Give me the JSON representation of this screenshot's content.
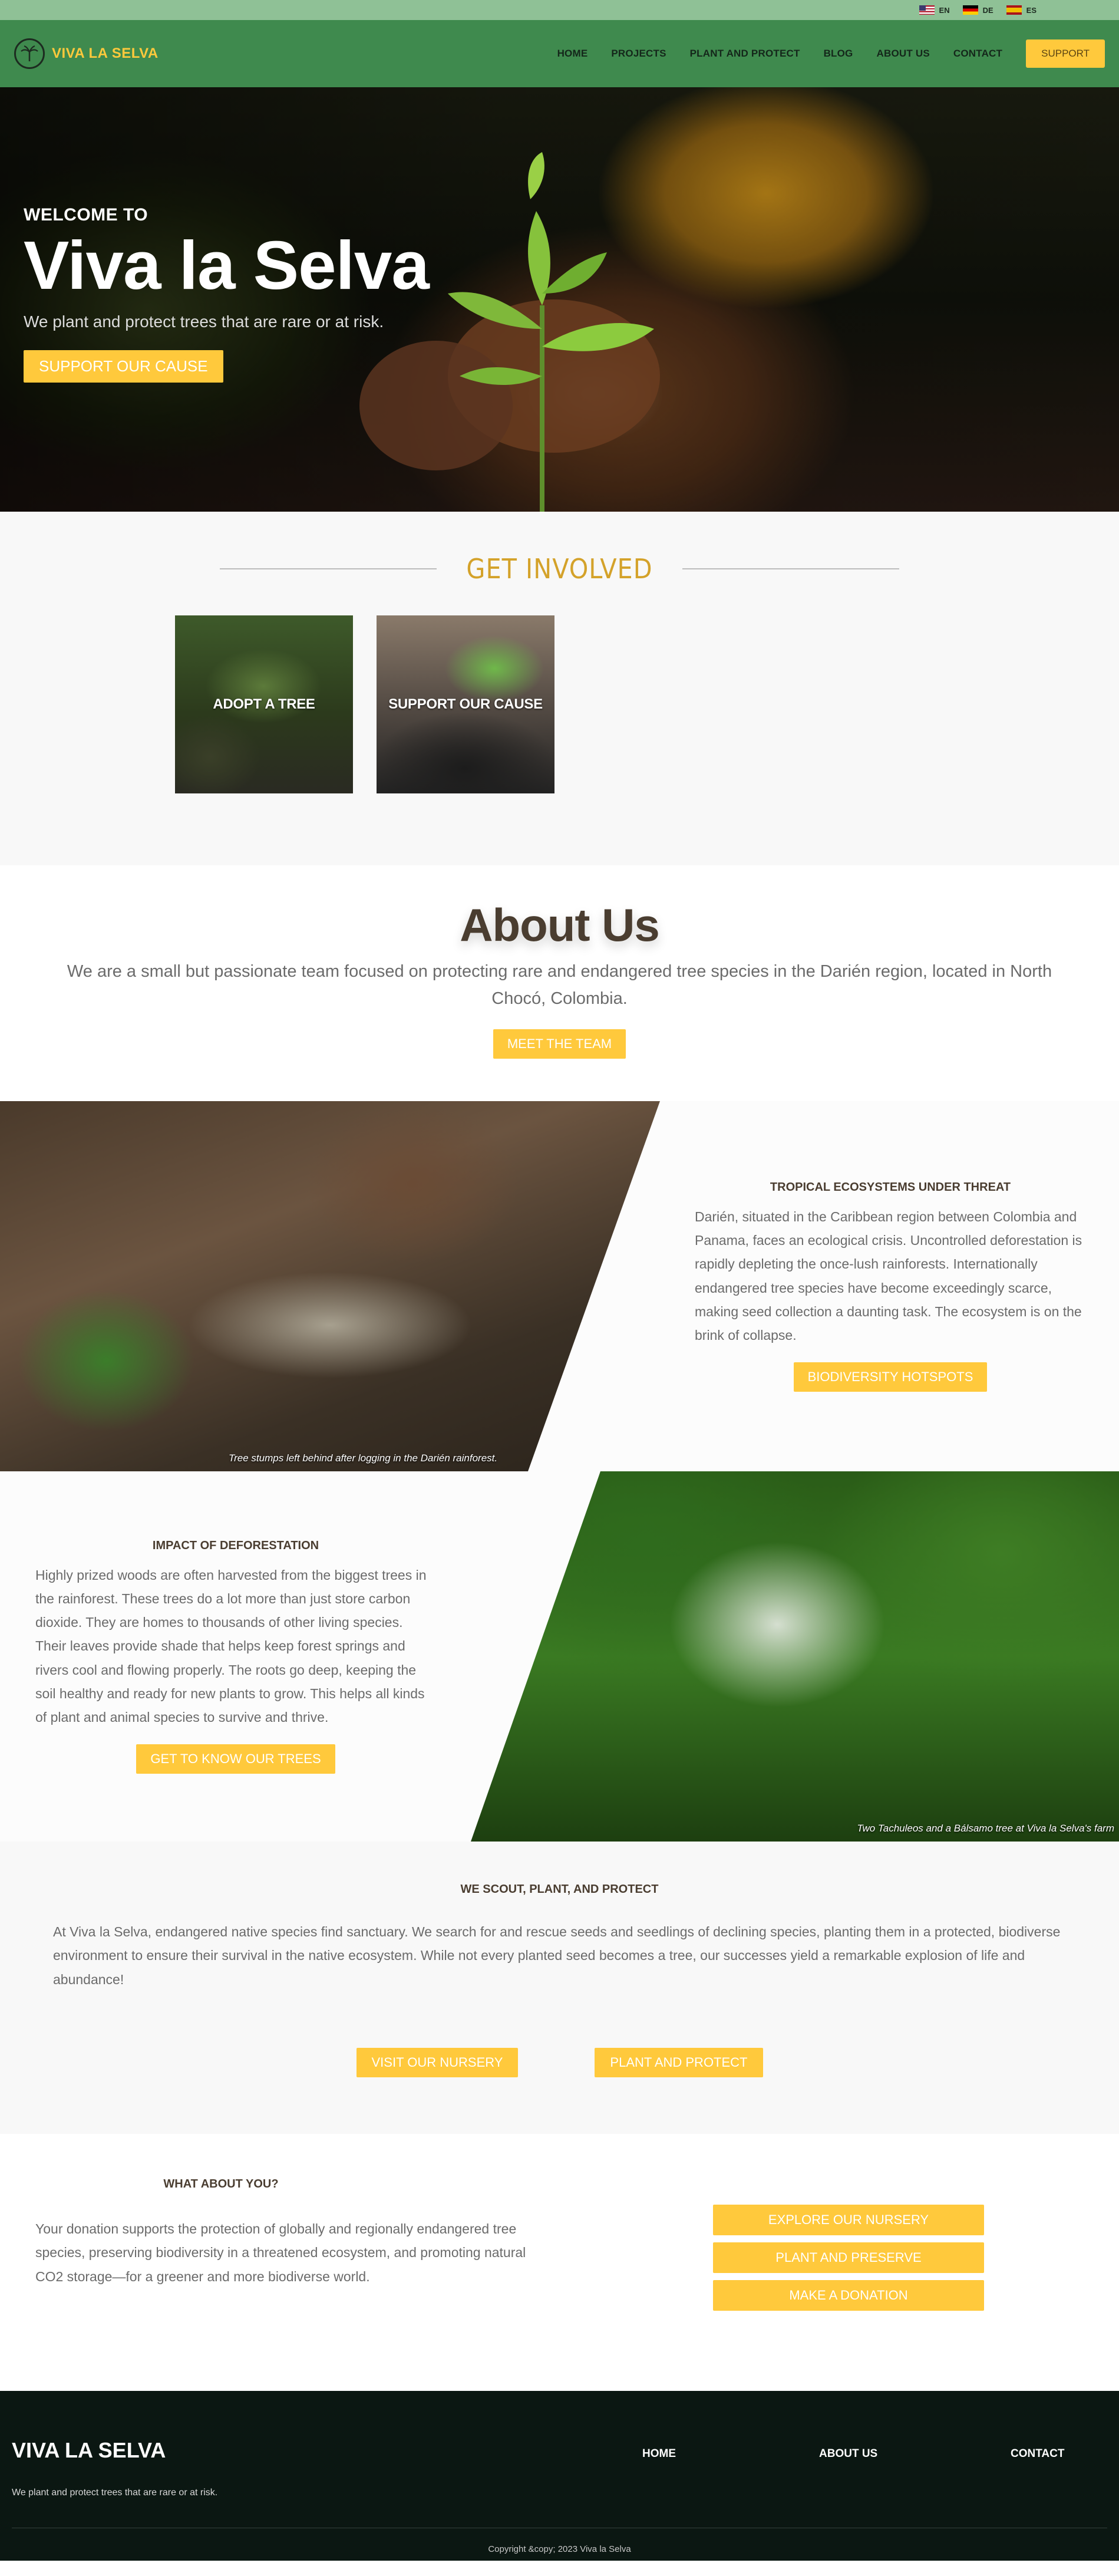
{
  "languages": [
    {
      "code": "EN"
    },
    {
      "code": "DE"
    },
    {
      "code": "ES"
    }
  ],
  "header": {
    "brand": "VIVA LA SELVA",
    "nav": [
      "HOME",
      "PROJECTS",
      "PLANT AND PROTECT",
      "BLOG",
      "ABOUT US",
      "CONTACT"
    ],
    "support_button": "SUPPORT"
  },
  "hero": {
    "welcome": "WELCOME TO",
    "title": "Viva la Selva",
    "subtitle": "We plant and protect trees that are rare or at risk.",
    "cta": "SUPPORT OUR CAUSE"
  },
  "involved": {
    "title": "GET INVOLVED",
    "cards": [
      "ADOPT A TREE",
      "SUPPORT OUR CAUSE"
    ]
  },
  "about": {
    "title": "About Us",
    "text": "We are a small but passionate team focused on protecting rare and endangered tree species in the Darién region, located in North Chocó, Colombia.",
    "button": "MEET THE TEAM"
  },
  "threat": {
    "heading": "TROPICAL ECOSYSTEMS UNDER THREAT",
    "body": "Darién, situated in the Caribbean region between Colombia and Panama, faces an ecological crisis. Uncontrolled deforestation is rapidly depleting the once-lush rainforests. Internationally endangered tree species have become exceedingly scarce, making seed collection a daunting task. The ecosystem is on the brink of collapse.",
    "button": "BIODIVERSITY HOTSPOTS",
    "caption": "Tree stumps left behind after logging in the Darién rainforest."
  },
  "impact": {
    "heading": "IMPACT OF DEFORESTATION",
    "body": "Highly prized woods are often harvested from the biggest trees in the rainforest. These trees do a lot more than just store carbon dioxide. They are homes to thousands of other living species. Their leaves provide shade that helps keep forest springs and rivers cool and flowing properly. The roots go deep, keeping the soil healthy and ready for new plants to grow. This helps all kinds of plant and animal species to survive and thrive.",
    "button": "GET TO KNOW OUR TREES",
    "caption": "Two Tachuleos and a Bálsamo tree at Viva la Selva's farm"
  },
  "scout": {
    "heading": "WE SCOUT, PLANT, AND PROTECT",
    "body": "At Viva la Selva, endangered native species find sanctuary. We search for and rescue seeds and seedlings of declining species, planting them in a protected, biodiverse environment to ensure their survival in the native ecosystem. While not every planted seed becomes a tree, our successes yield a remarkable explosion of life and abundance!",
    "buttons": [
      "VISIT OUR NURSERY",
      "PLANT AND PROTECT"
    ]
  },
  "you": {
    "heading": "WHAT ABOUT YOU?",
    "body": "Your donation supports the protection of globally and regionally endangered tree species, preserving biodiversity in a threatened ecosystem, and promoting natural CO2 storage—for a greener and more biodiverse world.",
    "buttons": [
      "EXPLORE OUR NURSERY",
      "PLANT AND PRESERVE",
      "MAKE A DONATION"
    ]
  },
  "footer": {
    "brand": "VIVA LA SELVA",
    "tagline": "We plant and protect trees that are rare or at risk.",
    "nav": [
      "HOME",
      "ABOUT US",
      "CONTACT"
    ],
    "copyright": "Copyright &copy; 2023 Viva la Selva"
  },
  "colors": {
    "accent": "#ffc93c",
    "header_green": "#3f8a4e",
    "lang_bar": "#8fc196",
    "footer_bg": "#0b1712"
  }
}
